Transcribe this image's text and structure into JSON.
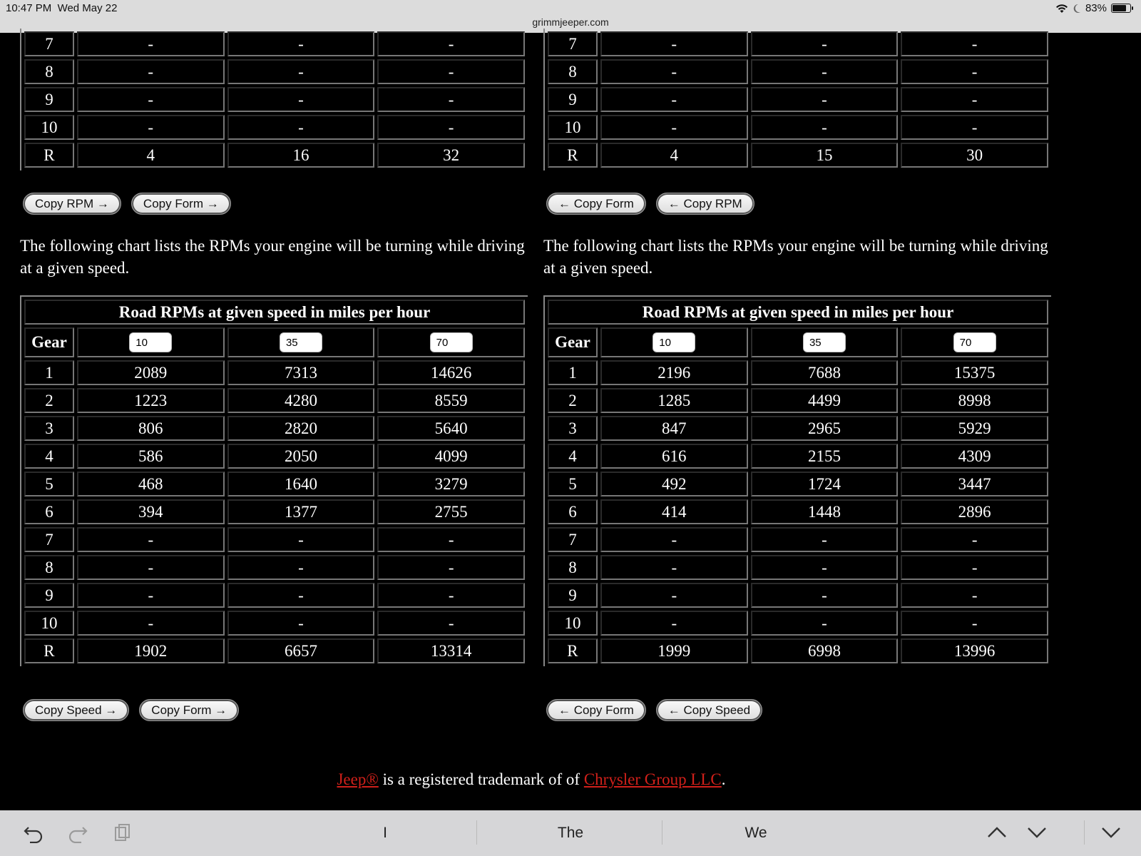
{
  "status": {
    "time": "10:47 PM",
    "date": "Wed May 22",
    "url": "grimmjeeper.com",
    "battery": "83%"
  },
  "left": {
    "top_rows": [
      {
        "gear": "7",
        "v": [
          "-",
          "-",
          "-"
        ]
      },
      {
        "gear": "8",
        "v": [
          "-",
          "-",
          "-"
        ]
      },
      {
        "gear": "9",
        "v": [
          "-",
          "-",
          "-"
        ]
      },
      {
        "gear": "10",
        "v": [
          "-",
          "-",
          "-"
        ]
      },
      {
        "gear": "R",
        "v": [
          "4",
          "16",
          "32"
        ]
      }
    ],
    "buttons1": [
      "Copy RPM →",
      "Copy Form →"
    ],
    "paragraph": "The following chart lists the RPMs your engine will be turning while driving at a given speed.",
    "caption": "Road RPMs at given speed in miles per hour",
    "gear_header": "Gear",
    "speeds": [
      "10",
      "35",
      "70"
    ],
    "rows": [
      {
        "gear": "1",
        "v": [
          "2089",
          "7313",
          "14626"
        ]
      },
      {
        "gear": "2",
        "v": [
          "1223",
          "4280",
          "8559"
        ]
      },
      {
        "gear": "3",
        "v": [
          "806",
          "2820",
          "5640"
        ]
      },
      {
        "gear": "4",
        "v": [
          "586",
          "2050",
          "4099"
        ]
      },
      {
        "gear": "5",
        "v": [
          "468",
          "1640",
          "3279"
        ]
      },
      {
        "gear": "6",
        "v": [
          "394",
          "1377",
          "2755"
        ]
      },
      {
        "gear": "7",
        "v": [
          "-",
          "-",
          "-"
        ]
      },
      {
        "gear": "8",
        "v": [
          "-",
          "-",
          "-"
        ]
      },
      {
        "gear": "9",
        "v": [
          "-",
          "-",
          "-"
        ]
      },
      {
        "gear": "10",
        "v": [
          "-",
          "-",
          "-"
        ]
      },
      {
        "gear": "R",
        "v": [
          "1902",
          "6657",
          "13314"
        ]
      }
    ],
    "buttons2": [
      "Copy Speed →",
      "Copy Form →"
    ]
  },
  "right": {
    "top_rows": [
      {
        "gear": "7",
        "v": [
          "-",
          "-",
          "-"
        ]
      },
      {
        "gear": "8",
        "v": [
          "-",
          "-",
          "-"
        ]
      },
      {
        "gear": "9",
        "v": [
          "-",
          "-",
          "-"
        ]
      },
      {
        "gear": "10",
        "v": [
          "-",
          "-",
          "-"
        ]
      },
      {
        "gear": "R",
        "v": [
          "4",
          "15",
          "30"
        ]
      }
    ],
    "buttons1": [
      "← Copy Form",
      "← Copy RPM"
    ],
    "paragraph": "The following chart lists the RPMs your engine will be turning while driving at a given speed.",
    "caption": "Road RPMs at given speed in miles per hour",
    "gear_header": "Gear",
    "speeds": [
      "10",
      "35",
      "70"
    ],
    "rows": [
      {
        "gear": "1",
        "v": [
          "2196",
          "7688",
          "15375"
        ]
      },
      {
        "gear": "2",
        "v": [
          "1285",
          "4499",
          "8998"
        ]
      },
      {
        "gear": "3",
        "v": [
          "847",
          "2965",
          "5929"
        ]
      },
      {
        "gear": "4",
        "v": [
          "616",
          "2155",
          "4309"
        ]
      },
      {
        "gear": "5",
        "v": [
          "492",
          "1724",
          "3447"
        ]
      },
      {
        "gear": "6",
        "v": [
          "414",
          "1448",
          "2896"
        ]
      },
      {
        "gear": "7",
        "v": [
          "-",
          "-",
          "-"
        ]
      },
      {
        "gear": "8",
        "v": [
          "-",
          "-",
          "-"
        ]
      },
      {
        "gear": "9",
        "v": [
          "-",
          "-",
          "-"
        ]
      },
      {
        "gear": "10",
        "v": [
          "-",
          "-",
          "-"
        ]
      },
      {
        "gear": "R",
        "v": [
          "1999",
          "6998",
          "13996"
        ]
      }
    ],
    "buttons2": [
      "← Copy Form",
      "← Copy Speed"
    ]
  },
  "footer": {
    "jeep_link": "Jeep®",
    "middle": " is a registered trademark of of ",
    "chrysler_link": "Chrysler Group LLC",
    "end": "."
  },
  "keyboard_bar": {
    "suggestions": [
      "I",
      "The",
      "We"
    ],
    "icons": [
      "undo-icon",
      "redo-icon",
      "paste-icon",
      "chevron-up-icon",
      "chevron-down-icon",
      "dismiss-keyboard-icon"
    ]
  }
}
